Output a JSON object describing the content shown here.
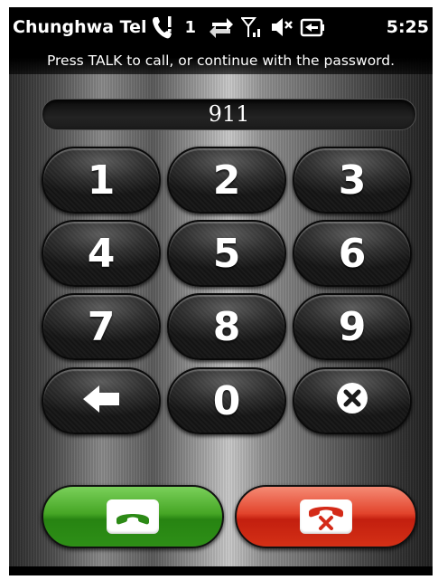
{
  "status_bar": {
    "carrier": "Chunghwa Tel",
    "indicator_number": "1",
    "time": "5:25",
    "icons": [
      "missed-call-icon",
      "data-transfer-icon",
      "signal-icon",
      "speaker-muted-icon",
      "battery-charging-icon"
    ]
  },
  "instruction": "Press TALK to call, or continue with the password.",
  "display": {
    "value": "911"
  },
  "keypad": {
    "keys": [
      "1",
      "2",
      "3",
      "4",
      "5",
      "6",
      "7",
      "8",
      "9",
      "",
      "0",
      ""
    ],
    "icons": {
      "backspace": "backspace-arrow-icon",
      "clear": "clear-x-icon"
    }
  },
  "actions": {
    "talk_icon": "phone-handset-icon",
    "end_icon": "hang-up-icon"
  },
  "colors": {
    "talk_green": "#3c9e1f",
    "end_red": "#d43016",
    "end_icon_red": "#d42a18",
    "talk_icon_green": "#2c8a16"
  }
}
